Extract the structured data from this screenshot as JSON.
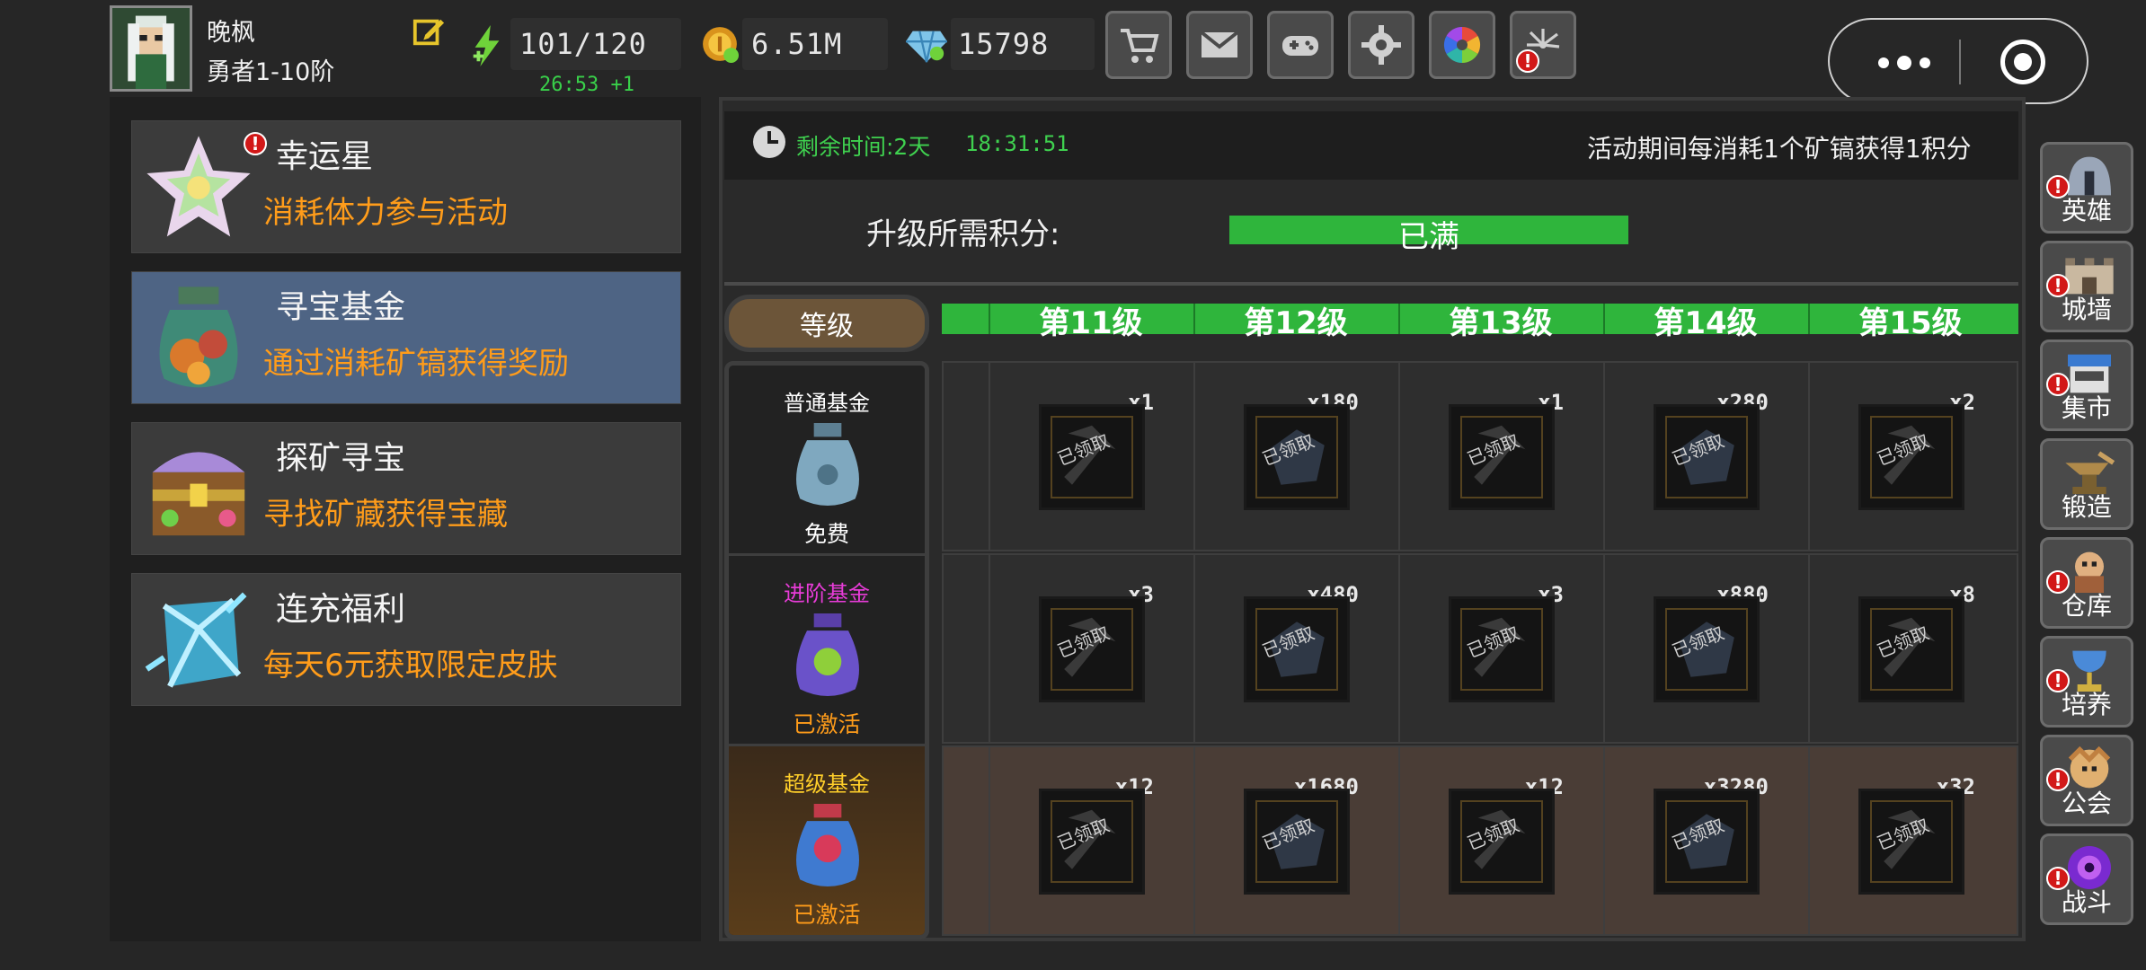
{
  "player": {
    "name": "晚枫",
    "rank": "勇者1-10阶"
  },
  "resources": {
    "stamina": "101/120",
    "stamina_timer": "26:53 +1",
    "gold": "6.51M",
    "gems": "15798"
  },
  "toolbar": [
    {
      "icon": "cart-icon",
      "alert": false
    },
    {
      "icon": "mail-icon",
      "alert": false
    },
    {
      "icon": "gamepad-icon",
      "alert": false
    },
    {
      "icon": "gear-icon",
      "alert": false
    },
    {
      "icon": "color-wheel-icon",
      "alert": false
    },
    {
      "icon": "firework-icon",
      "alert": true
    }
  ],
  "events": [
    {
      "title": "幸运星",
      "desc": "消耗体力参与活动",
      "alert": true,
      "active": false
    },
    {
      "title": "寻宝基金",
      "desc": "通过消耗矿镐获得奖励",
      "alert": false,
      "active": true
    },
    {
      "title": "探矿寻宝",
      "desc": "寻找矿藏获得宝藏",
      "alert": false,
      "active": false
    },
    {
      "title": "连充福利",
      "desc": "每天6元获取限定皮肤",
      "alert": false,
      "active": false
    }
  ],
  "activity": {
    "time_label": "剩余时间:2天",
    "time_value": "18:31:51",
    "note": "活动期间每消耗1个矿镐获得1积分",
    "upgrade_label": "升级所需积分:",
    "upgrade_status": "已满",
    "level_header": "等级"
  },
  "levels": [
    "第11级",
    "第12级",
    "第13级",
    "第14级",
    "第15级"
  ],
  "funds": [
    {
      "name": "普通基金",
      "status": "免费",
      "name_color": "#ffffff",
      "status_color": "#ffffff",
      "items": [
        {
          "qty": "x1"
        },
        {
          "qty": "x180"
        },
        {
          "qty": "x1"
        },
        {
          "qty": "x280"
        },
        {
          "qty": "x2"
        }
      ]
    },
    {
      "name": "进阶基金",
      "status": "已激活",
      "name_color": "#e83cd8",
      "status_color": "#ff9c1a",
      "items": [
        {
          "qty": "x3"
        },
        {
          "qty": "x480"
        },
        {
          "qty": "x3"
        },
        {
          "qty": "x880"
        },
        {
          "qty": "x8"
        }
      ]
    },
    {
      "name": "超级基金",
      "status": "已激活",
      "name_color": "#ffcf2a",
      "status_color": "#ff9c1a",
      "items": [
        {
          "qty": "x12"
        },
        {
          "qty": "x1680"
        },
        {
          "qty": "x12"
        },
        {
          "qty": "x3280"
        },
        {
          "qty": "x32"
        }
      ]
    }
  ],
  "claimed_label": "已领取",
  "side_nav": [
    {
      "label": "英雄",
      "icon": "helmet-icon",
      "alert": true
    },
    {
      "label": "城墙",
      "icon": "wall-icon",
      "alert": true
    },
    {
      "label": "集市",
      "icon": "market-icon",
      "alert": true
    },
    {
      "label": "锻造",
      "icon": "anvil-icon",
      "alert": false
    },
    {
      "label": "仓库",
      "icon": "warehouse-icon",
      "alert": true
    },
    {
      "label": "培养",
      "icon": "chalice-icon",
      "alert": true
    },
    {
      "label": "公会",
      "icon": "guild-icon",
      "alert": true
    },
    {
      "label": "战斗",
      "icon": "portal-icon",
      "alert": true
    }
  ]
}
